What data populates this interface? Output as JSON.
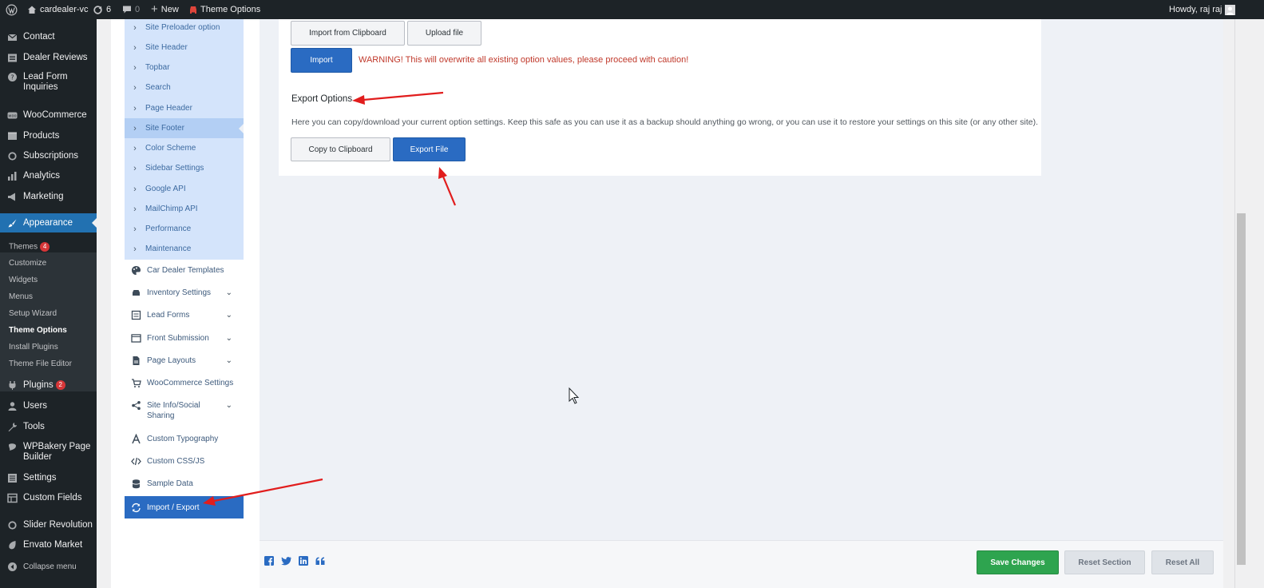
{
  "adminbar": {
    "site_name": "cardealer-vc",
    "updates_count": "6",
    "comments_count": "0",
    "new_label": "New",
    "theme_options_label": "Theme Options",
    "howdy": "Howdy, raj raj"
  },
  "menu": {
    "contact": "Contact",
    "dealer_reviews": "Dealer Reviews",
    "lead_form_inquiries_1": "Lead Form",
    "lead_form_inquiries_2": "Inquiries",
    "woocommerce": "WooCommerce",
    "products": "Products",
    "subscriptions": "Subscriptions",
    "analytics": "Analytics",
    "marketing": "Marketing",
    "appearance": "Appearance",
    "sub_themes": "Themes",
    "sub_themes_badge": "4",
    "sub_customize": "Customize",
    "sub_widgets": "Widgets",
    "sub_menus": "Menus",
    "sub_setup_wizard": "Setup Wizard",
    "sub_theme_options": "Theme Options",
    "sub_install_plugins": "Install Plugins",
    "sub_theme_file_editor": "Theme File Editor",
    "plugins": "Plugins",
    "plugins_badge": "2",
    "users": "Users",
    "tools": "Tools",
    "wpbakery_1": "WPBakery Page",
    "wpbakery_2": "Builder",
    "settings": "Settings",
    "custom_fields": "Custom Fields",
    "slider_revolution": "Slider Revolution",
    "envato_market": "Envato Market",
    "collapse": "Collapse menu"
  },
  "options_nav": {
    "sub": [
      "Site Preloader option",
      "Site Header",
      "Topbar",
      "Search",
      "Page Header",
      "Site Footer",
      "Color Scheme",
      "Sidebar Settings",
      "Google API",
      "MailChimp API",
      "Performance",
      "Maintenance"
    ],
    "car_dealer_templates": "Car Dealer Templates",
    "inventory_settings": "Inventory Settings",
    "lead_forms": "Lead Forms",
    "front_submission": "Front Submission",
    "page_layouts": "Page Layouts",
    "woocommerce_settings": "WooCommerce Settings",
    "site_info_1": "Site Info/Social",
    "site_info_2": "Sharing",
    "custom_typography": "Custom Typography",
    "custom_css_js": "Custom CSS/JS",
    "sample_data": "Sample Data",
    "import_export": "Import / Export"
  },
  "import_section": {
    "import_from_clipboard": "Import from Clipboard",
    "upload_file": "Upload file",
    "import_button": "Import",
    "warning": "WARNING! This will overwrite all existing option values, please proceed with caution!"
  },
  "export_section": {
    "title": "Export Options",
    "description": "Here you can copy/download your current option settings. Keep this safe as you can use it as a backup should anything go wrong, or you can use it to restore your settings on this site (or any other site).",
    "copy_to_clipboard": "Copy to Clipboard",
    "export_file": "Export File"
  },
  "footer": {
    "save_changes": "Save Changes",
    "reset_section": "Reset Section",
    "reset_all": "Reset All"
  },
  "colors": {
    "admin_dark": "#1d2327",
    "accent_blue": "#2a6bc2",
    "save_green": "#2ea44f",
    "warning_red": "#c0392b",
    "annotation_red": "#e11d1d"
  }
}
